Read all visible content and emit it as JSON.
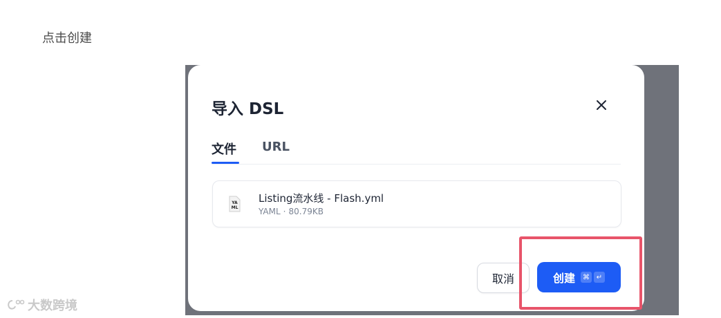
{
  "caption": "点击创建",
  "dialog": {
    "title": "导入 DSL",
    "close_icon": "close-icon",
    "tabs": [
      {
        "label": "文件",
        "active": true
      },
      {
        "label": "URL",
        "active": false
      }
    ],
    "file": {
      "icon": "yaml-file-icon",
      "icon_text": "YA ML",
      "name": "Listing流水线 - Flash.yml",
      "type": "YAML",
      "separator": "·",
      "size": "80.79KB"
    },
    "buttons": {
      "cancel_label": "取消",
      "create_label": "创建",
      "create_shortcut": [
        "⌘",
        "↵"
      ]
    }
  },
  "watermark": "大数跨境",
  "colors": {
    "primary": "#1d5cf5",
    "overlay": "#6f727a",
    "highlight": "#e8546a"
  }
}
